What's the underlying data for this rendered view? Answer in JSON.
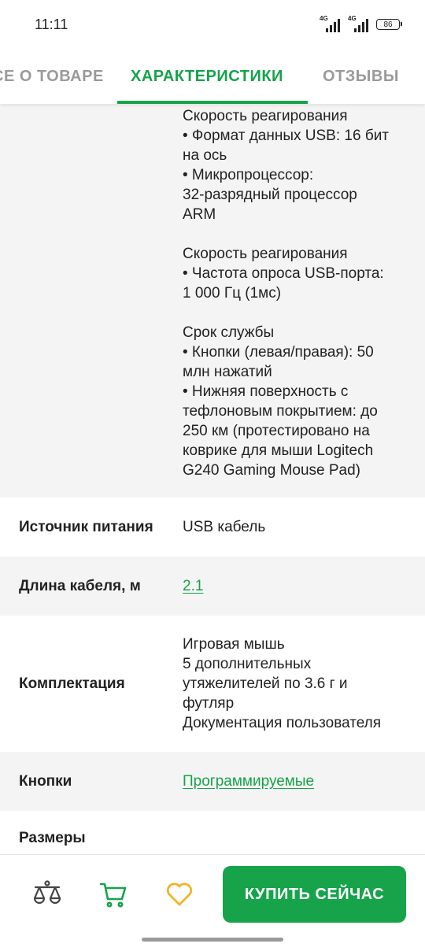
{
  "status_bar": {
    "time": "11:11",
    "network1": "4G",
    "network2": "4G",
    "battery": "86"
  },
  "tabs": [
    {
      "label": "СЕ О ТОВАРЕ",
      "active": false
    },
    {
      "label": "ХАРАКТЕРИСТИКИ",
      "active": true
    },
    {
      "label": "ОТЗЫВЫ",
      "active": false
    }
  ],
  "specs_top": {
    "blocks": [
      [
        "Скорость реагирования",
        "• Формат данных USB: 16 бит",
        "на ось",
        "• Микропроцессор:",
        "32-разрядный процессор",
        "ARM"
      ],
      [
        "Скорость реагирования",
        "• Частота опроса USB-порта:",
        "1 000 Гц (1мс)"
      ],
      [
        "Срок службы",
        "• Кнопки (левая/правая): 50",
        "млн нажатий",
        "• Нижняя поверхность с",
        "тефлоновым покрытием: до",
        "250 км (протестировано на",
        "коврике для мыши Logitech",
        "G240 Gaming Mouse Pad)"
      ]
    ]
  },
  "specs": [
    {
      "label": "Источник питания",
      "value": "USB кабель"
    },
    {
      "label": "Длина кабеля, м",
      "value": "2.1"
    },
    {
      "label": "Комплектация",
      "lines": [
        "Игровая мышь",
        "5 дополнительных",
        "утяжелителей по 3.6 г и",
        "футляр",
        "Документация пользователя"
      ]
    },
    {
      "label": "Кнопки",
      "value": "Программируемые"
    },
    {
      "label": "Размеры"
    }
  ],
  "bottom_bar": {
    "buy_label": "КУПИТЬ СЕЙЧАС"
  },
  "colors": {
    "accent": "#16a34a",
    "heart": "#f0b429",
    "gray_row": "#f4f4f4",
    "inactive_tab": "#9a9a9a"
  }
}
